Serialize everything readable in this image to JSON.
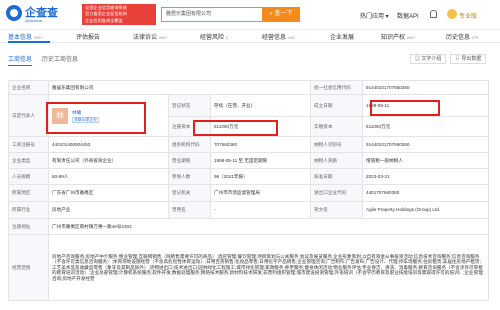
{
  "header": {
    "brand": "企查查",
    "brand_en": "Qichacha",
    "slogan_lines": [
      "全国企业信用查询系统",
      "官方备案企业征信机构",
      "企业信用查询全覆盖"
    ],
    "search_value": "雅居乐集团有限公司",
    "search_button": "查一下",
    "nav": [
      "热门应用 ▾",
      "数据API"
    ],
    "vip_label": "专业版"
  },
  "tabs": [
    {
      "label": "基本信息",
      "count": "999+"
    },
    {
      "label": "评估报告",
      "count": ""
    },
    {
      "label": "法律诉讼",
      "count": "999+"
    },
    {
      "label": "经营风险",
      "count": "2"
    },
    {
      "label": "经营信息",
      "count": "426"
    },
    {
      "label": "企业发展",
      "count": ""
    },
    {
      "label": "知识产权",
      "count": "999+"
    },
    {
      "label": "历史信息",
      "count": "375"
    }
  ],
  "subtabs": {
    "current": "工商信息",
    "history": "历史工商信息",
    "btn1": "文字介绍",
    "btn2": "导出数据"
  },
  "rows": {
    "r1": {
      "label": "企业名称",
      "value": "雅居乐集团有限公司",
      "label2": "统一社会信用代码",
      "value2": "91440101707660360"
    },
    "r2": {
      "label": "法定代表人",
      "badge": "林",
      "name": "林曦",
      "sub": "关联50家企业",
      "label2": "登记状态",
      "value2": "存续（在营、开业）",
      "label3": "成立日期",
      "value3": "1998-05-11"
    },
    "r3": {
      "label2": "注册资本",
      "value2": "611000万元",
      "label3": "实缴资本",
      "value3": "611000万元"
    },
    "r4": {
      "label": "工商注册号",
      "value": "440101400004453",
      "label2": "组织机构代码",
      "value2": "707660360",
      "label3": "纳税人识别号",
      "value3": "91440101707660360"
    },
    "r5": {
      "label": "企业类型",
      "value": "有限责任公司（外商投资企业）",
      "label2": "营业期限",
      "value2": "1998-05-11 至 无固定期限",
      "label3": "纳税人资质",
      "value3": "增值税一般纳税人"
    },
    "r6": {
      "label": "人员规模",
      "value": "50-99人",
      "label2": "参保人数",
      "value2": "96（2021年报）",
      "label3": "核准日期",
      "value3": "2023-03-31"
    },
    "r7": {
      "label": "所属地区",
      "value": "广东省广州市番禺区",
      "label2": "登记机关",
      "value2": "广州市市场监督管理局",
      "label3": "进出口企业代码",
      "value3": "4401707660360"
    },
    "r8": {
      "label": "所属行业",
      "value": "房地产业",
      "label2": "曾用名",
      "value2": "-",
      "label3": "英文名",
      "value3": "Agile Property Holdings (Group) Ltd."
    },
    "r9": {
      "label": "注册地址",
      "value": "广州市番禺区南村镇万惠一路48号2302"
    },
    "r10": {
      "label": "经营范围",
      "value": "房地产咨询服务;房地产中介服务;物业管理;互联网销售（除销售需要许可的商品）;酒店管理;餐饮管理;项目策划与公关服务;会议及展览服务;企业形象策划;以自有资金从事投资活动;信息技术咨询服务;信息咨询服务（不含许可类信息咨询服务）;体育场地设施经营（不含高危险性体育运动）;日用百货销售;化妆品零售;日用化学产品销售;企业管理咨询;广告制作;广告发布;广告设计、代理;停车场服务;住房租赁;非居住房地产租赁;工艺美术品及收藏品零售（象牙及其制品除外）;货物进出口;技术进出口;园林绿化工程施工;城市绿化管理;家政服务;养老服务;健身休闲活动;物业服务评估;专业保洁、清洗、消毒服务;教育咨询服务（不含涉许可审批的教育培训活动）;企业总部管理;计算机系统服务;软件开发;数据处理服务;网络技术服务;新材料技术研发;非营利组织管理;城市建设投资管理;外语培训（不含学历教育及职业技能培训等需取得许可的培训）;企业管理咨询;房地产开发经营"
    }
  }
}
